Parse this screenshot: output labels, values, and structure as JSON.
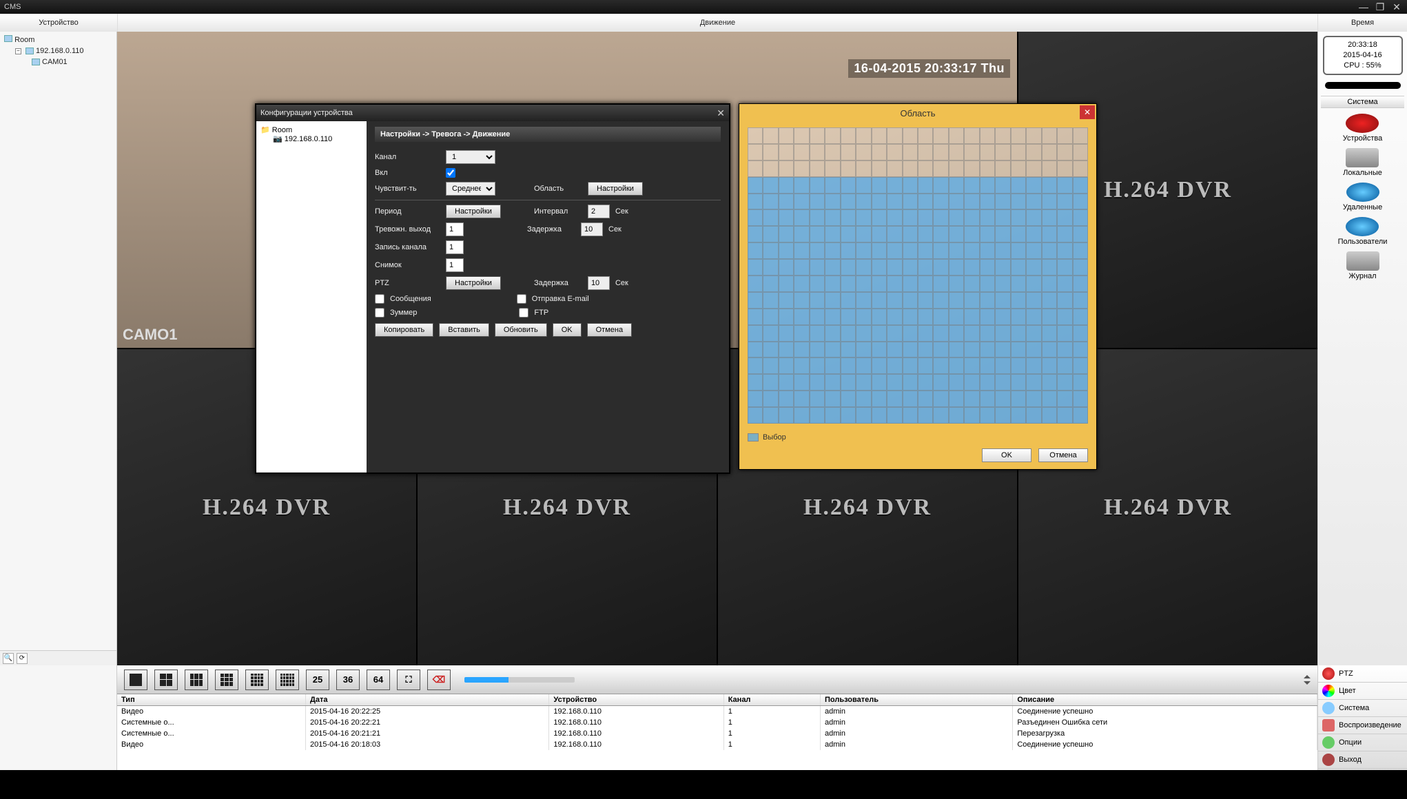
{
  "app": {
    "title": "CMS"
  },
  "menu": {
    "left": "Устройство",
    "center": "Движение",
    "right": "Время"
  },
  "tree": {
    "root": "Room",
    "ip": "192.168.0.110",
    "cam": "CAM01"
  },
  "cam": {
    "label": "CAMO1",
    "overlay": "16-04-2015 20:33:17 Thu",
    "logo": "H.264 DVR"
  },
  "clock": {
    "time": "20:33:18",
    "date": "2015-04-16",
    "cpu": "CPU : 55%"
  },
  "system": {
    "header": "Система",
    "items": [
      "Устройства",
      "Локальные",
      "Удаленные",
      "Пользователи",
      "Журнал"
    ]
  },
  "layoutbar": {
    "nums": [
      "25",
      "36",
      "64"
    ]
  },
  "log": {
    "cols": [
      "Тип",
      "Дата",
      "Устройство",
      "Канал",
      "Пользователь",
      "Описание"
    ],
    "rows": [
      [
        "Видео",
        "2015-04-16 20:22:25",
        "192.168.0.110",
        "1",
        "admin",
        "Соединение успешно"
      ],
      [
        "Системные о...",
        "2015-04-16 20:22:21",
        "192.168.0.110",
        "1",
        "admin",
        "Разъединен Ошибка сети"
      ],
      [
        "Системные о...",
        "2015-04-16 20:21:21",
        "192.168.0.110",
        "1",
        "admin",
        "Перезагрузка"
      ],
      [
        "Видео",
        "2015-04-16 20:18:03",
        "192.168.0.110",
        "1",
        "admin",
        "Соединение успешно"
      ]
    ]
  },
  "ract": [
    "PTZ",
    "Цвет",
    "Система",
    "Воспроизведение",
    "Опции",
    "Выход"
  ],
  "modal1": {
    "title": "Конфигурации устройства",
    "tree_root": "Room",
    "tree_ip": "192.168.0.110",
    "breadcrumb": "Настройки -> Тревога -> Движение",
    "labels": {
      "channel": "Канал",
      "enable": "Вкл",
      "sensitivity": "Чувствит-ть",
      "region": "Область",
      "period": "Период",
      "interval": "Интервал",
      "alarm_out": "Тревожн. выход",
      "delay": "Задержка",
      "record_ch": "Запись канала",
      "snapshot": "Снимок",
      "ptz": "PTZ",
      "messages": "Сообщения",
      "buzzer": "Зуммер",
      "email": "Отправка E-mail",
      "ftp": "FTP",
      "sec": "Сек"
    },
    "values": {
      "channel_sel": "1",
      "sensitivity_sel": "Среднее",
      "interval": "2",
      "delay": "10",
      "ptz_delay": "10",
      "alarm_out": "1",
      "record_ch": "1",
      "snapshot": "1",
      "enable": true,
      "messages": false,
      "buzzer": false,
      "email": false,
      "ftp": false
    },
    "buttons": {
      "settings": "Настройки",
      "copy": "Копировать",
      "paste": "Вставить",
      "refresh": "Обновить",
      "ok": "OK",
      "cancel": "Отмена"
    }
  },
  "modal2": {
    "title": "Область",
    "legend": "Выбор",
    "ok": "OK",
    "cancel": "Отмена",
    "unselected_rows": 3
  }
}
